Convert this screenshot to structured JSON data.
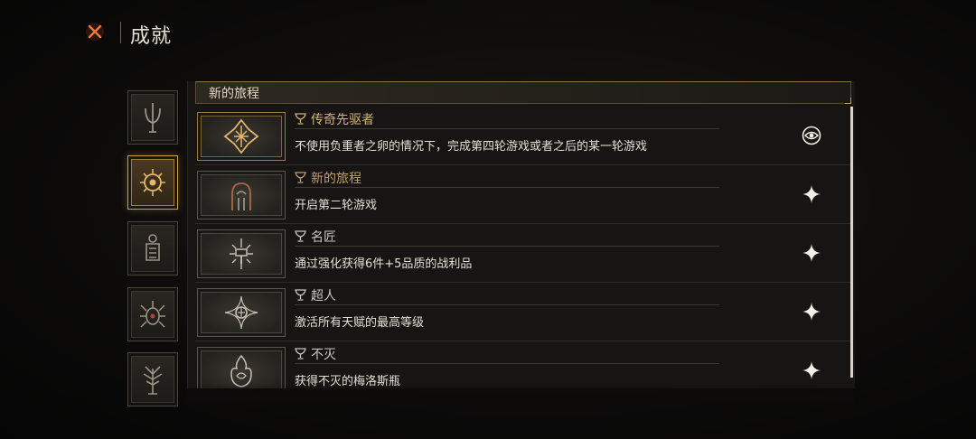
{
  "header": {
    "title": "成就"
  },
  "categories": [
    {
      "icon": "trident-emblem-icon",
      "active": false
    },
    {
      "icon": "sun-emblem-icon",
      "active": true
    },
    {
      "icon": "shrine-emblem-icon",
      "active": false
    },
    {
      "icon": "beetle-emblem-icon",
      "active": false
    },
    {
      "icon": "tree-emblem-icon",
      "active": false
    }
  ],
  "section": {
    "title": "新的旅程"
  },
  "achievements": [
    {
      "name": "传奇先驱者",
      "description": "不使用负重者之卵的情况下，完成第四轮游戏或者之后的某一轮游戏",
      "tier": "gold",
      "icon": "rune-sigil-icon",
      "status_icon": "eye-emblem-icon"
    },
    {
      "name": "新的旅程",
      "description": "开启第二轮游戏",
      "tier": "bronze",
      "icon": "portal-arch-icon",
      "status_icon": "sparkle-icon"
    },
    {
      "name": "名匠",
      "description": "通过强化获得6件+5品质的战利品",
      "tier": "silver",
      "icon": "hammer-burst-icon",
      "status_icon": "sparkle-icon"
    },
    {
      "name": "超人",
      "description": "激活所有天赋的最高等级",
      "tier": "silver",
      "icon": "star-orb-icon",
      "status_icon": "sparkle-icon"
    },
    {
      "name": "不灭",
      "description": "获得不灭的梅洛斯瓶",
      "tier": "silver",
      "icon": "flame-vessel-icon",
      "status_icon": "sparkle-icon"
    }
  ],
  "colors": {
    "gold": "#d2b27a",
    "bronze": "#c29c72",
    "silver": "#c9c6bf",
    "accent_close": "#e8773a"
  }
}
